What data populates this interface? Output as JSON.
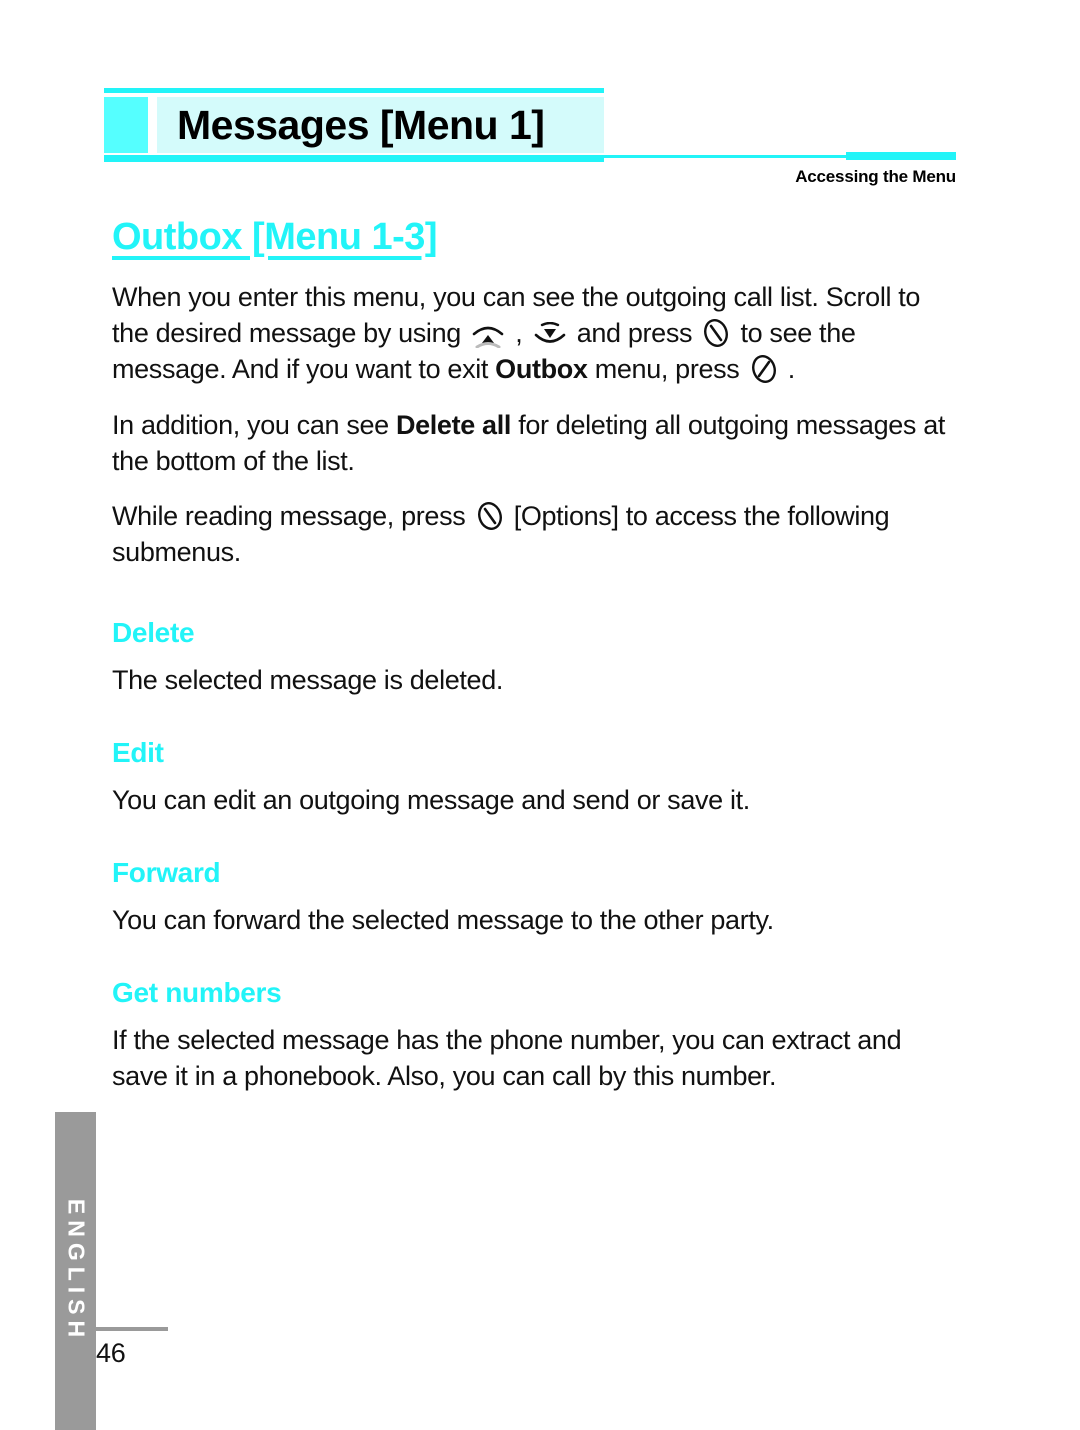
{
  "header": {
    "title": "Messages [Menu 1]",
    "running_head": "Accessing the Menu",
    "accent_color": "#22f4f8",
    "swatch_color": "#55ffff",
    "band_color": "#d4fbfb"
  },
  "section": {
    "heading": "Outbox [Menu 1-3]",
    "heading_color": "#22f4f8"
  },
  "paragraphs": {
    "p1_a": "When you enter this menu, you can see the outgoing call list. Scroll to the desired message by using",
    "p1_comma": ",",
    "p1_b": "and press",
    "p1_c": "to see the message. And if you want to exit",
    "p1_bold": "Outbox",
    "p1_d": "menu, press",
    "p1_period": ".",
    "p2_a": "In addition, you can see",
    "p2_bold": "Delete all",
    "p2_b": "for deleting all outgoing messages at the bottom of the list.",
    "p3_a": "While reading message, press",
    "p3_b": "[Options] to access the following submenus."
  },
  "icons": {
    "up_key": "up-navigation-key-icon",
    "down_key": "down-navigation-key-icon",
    "send_key": "send-call-key-icon",
    "end_key": "end-call-key-icon",
    "options_key": "send-call-key-icon"
  },
  "subsections": [
    {
      "heading": "Delete",
      "body": "The selected message is deleted."
    },
    {
      "heading": "Edit",
      "body": "You can edit an outgoing message and send or save it."
    },
    {
      "heading": "Forward",
      "body": "You can forward the selected message to the other party."
    },
    {
      "heading": "Get numbers",
      "body": "If the selected message has the phone number, you can extract and save it in a phonebook. Also, you can call by this number."
    }
  ],
  "footer": {
    "language_tab": "ENGLISH",
    "page_number": "46",
    "tab_color": "#9a9a9a"
  }
}
